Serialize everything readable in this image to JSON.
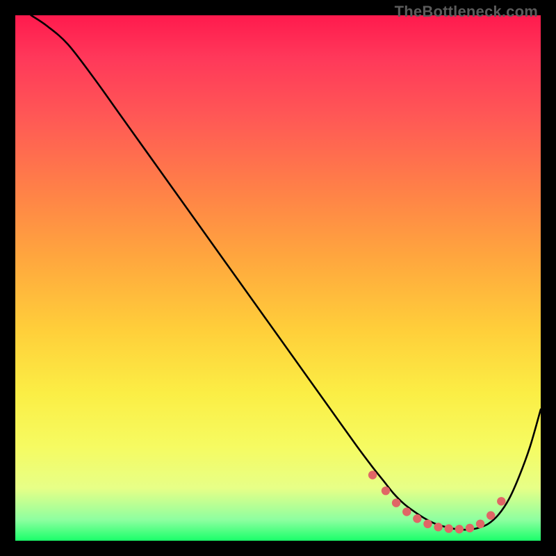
{
  "watermark": "TheBottleneck.com",
  "colors": {
    "page_bg": "#000000",
    "curve_stroke": "#000000",
    "dot_fill": "#e06666",
    "gradient_top": "#ff1a4d",
    "gradient_bottom": "#1aff6a"
  },
  "chart_data": {
    "type": "line",
    "title": "",
    "xlabel": "",
    "ylabel": "",
    "xlim": [
      0,
      100
    ],
    "ylim": [
      0,
      100
    ],
    "grid": false,
    "legend": false,
    "annotations": [
      "TheBottleneck.com"
    ],
    "series": [
      {
        "name": "bottleneck-curve",
        "x": [
          3,
          6,
          10,
          15,
          20,
          25,
          30,
          35,
          40,
          45,
          50,
          55,
          60,
          65,
          68,
          70,
          72,
          74,
          76,
          78,
          80,
          82,
          84,
          86,
          88,
          90,
          92,
          94,
          96,
          98,
          100
        ],
        "values": [
          100,
          98,
          94.5,
          88,
          81,
          74,
          67,
          60,
          53,
          46,
          39,
          32,
          25,
          18,
          14,
          11.5,
          9,
          7,
          5.5,
          4.2,
          3.2,
          2.6,
          2.2,
          2.1,
          2.4,
          3.2,
          5,
          8,
          12.5,
          18,
          25
        ]
      }
    ],
    "dots": {
      "name": "highlight-dots",
      "x": [
        68,
        70.5,
        72.5,
        74.5,
        76.5,
        78.5,
        80.5,
        82.5,
        84.5,
        86.5,
        88.5,
        90.5,
        92.5
      ],
      "values": [
        12.5,
        9.5,
        7.2,
        5.5,
        4.2,
        3.2,
        2.6,
        2.3,
        2.2,
        2.4,
        3.2,
        4.8,
        7.5
      ]
    }
  }
}
